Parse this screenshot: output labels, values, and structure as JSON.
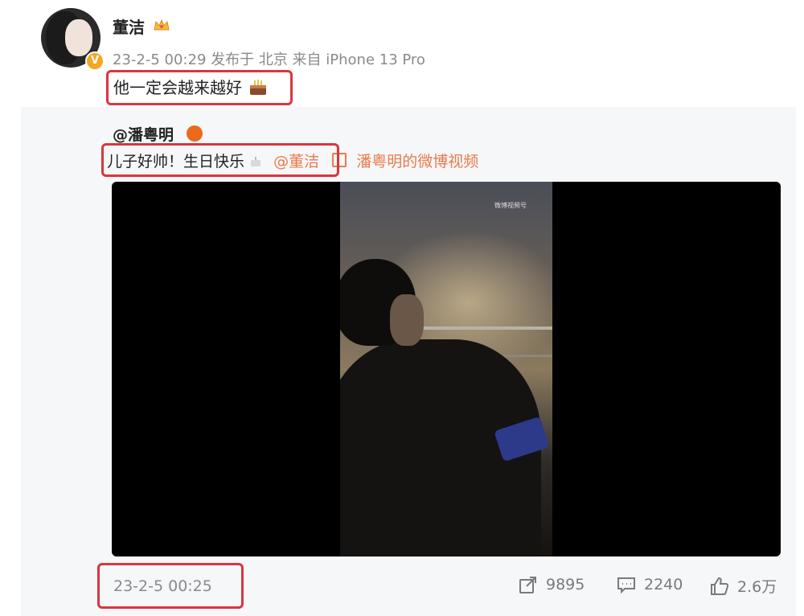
{
  "post": {
    "author": "董洁",
    "meta": "23-2-5 00:29 发布于 北京 来自 iPhone 13 Pro",
    "text": "他一定会越来越好",
    "verified_badge": "V"
  },
  "repost": {
    "author": "@潘粤明",
    "text": "儿子好帅！生日快乐",
    "mention": "@董洁",
    "video_link": "潘粤明的微博视频",
    "video_watermark": "微博视频号",
    "time": "23-2-5 00:25",
    "shares": "9895",
    "comments": "2240",
    "likes": "2.6万"
  },
  "colors": {
    "highlight": "#d9363e",
    "link": "#e87a4a",
    "repost_bg": "#f6f7f9",
    "badge_gold": "#f5a623"
  },
  "icons": {
    "crown": "crown-icon",
    "cake": "cake-icon",
    "share": "share-icon",
    "comment": "comment-icon",
    "like": "like-icon"
  }
}
